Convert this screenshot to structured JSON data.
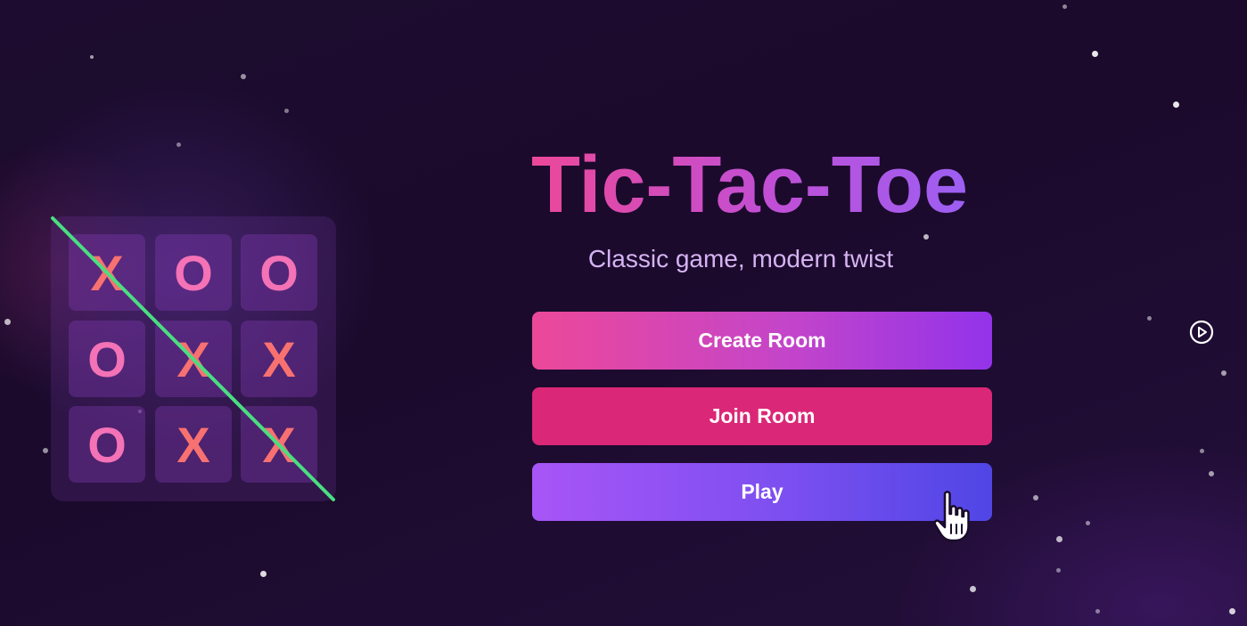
{
  "app": {
    "title": "Tic-Tac-Toe",
    "subtitle": "Classic game, modern twist"
  },
  "board": {
    "cells": [
      "X",
      "O",
      "O",
      "O",
      "X",
      "X",
      "O",
      "X",
      "X"
    ],
    "winning_cells": [
      0,
      4,
      8
    ],
    "win_line_color": "#4ade80"
  },
  "buttons": {
    "create_room": "Create Room",
    "join_room": "Join Room",
    "play": "Play"
  },
  "icons": {
    "play_circle": "play-circle-icon",
    "pointer": "hand-pointer-cursor-icon"
  },
  "colors": {
    "x_mark": "#f87171",
    "o_mark": "#f472b6",
    "title_gradient_start": "#ec4899",
    "title_gradient_end": "#9a60f5",
    "join_button": "#db2777",
    "play_gradient_start": "#a855f7",
    "play_gradient_end": "#4f46e5",
    "background": "#1d0c2f"
  }
}
